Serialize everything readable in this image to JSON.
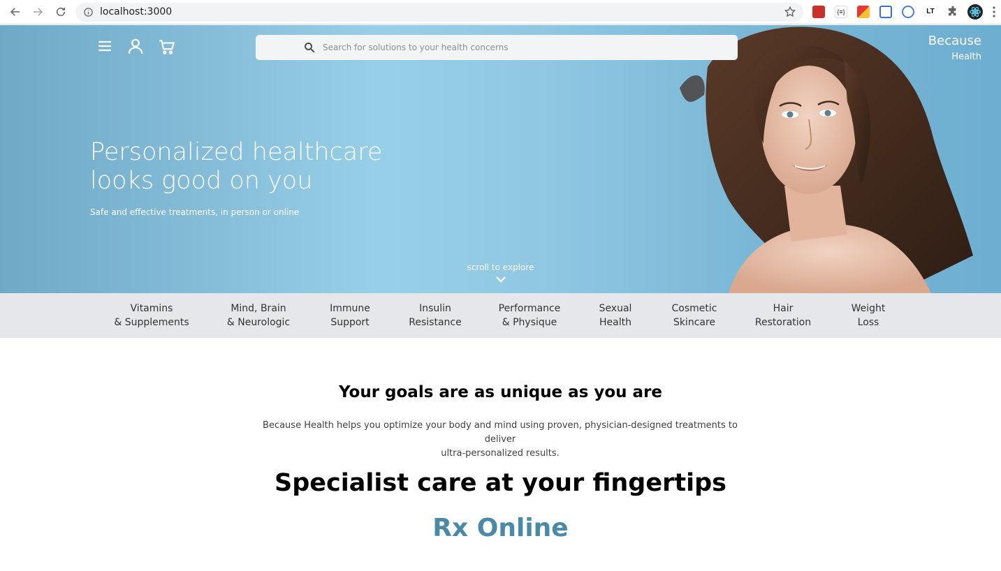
{
  "browser": {
    "url": "localhost:3000"
  },
  "search": {
    "placeholder": "Search for solutions to your health concerns"
  },
  "brand": {
    "line1": "Because",
    "line2": "Health"
  },
  "hero": {
    "headline_line1": "Personalized healthcare",
    "headline_line2": "looks good on you",
    "subtitle": "Safe and effective treatments, in person or online",
    "scroll_label": "scroll to explore"
  },
  "categories": [
    {
      "line1": "Vitamins",
      "line2": "& Supplements"
    },
    {
      "line1": "Mind, Brain",
      "line2": "& Neurologic"
    },
    {
      "line1": "Immune",
      "line2": "Support"
    },
    {
      "line1": "Insulin",
      "line2": "Resistance"
    },
    {
      "line1": "Performance",
      "line2": "& Physique"
    },
    {
      "line1": "Sexual",
      "line2": "Health"
    },
    {
      "line1": "Cosmetic",
      "line2": "Skincare"
    },
    {
      "line1": "Hair",
      "line2": "Restoration"
    },
    {
      "line1": "Weight",
      "line2": "Loss"
    }
  ],
  "content": {
    "goals_title": "Your goals are as unique as you are",
    "goals_desc_line1": "Because Health helps you optimize your body and mind using proven, physician-designed treatments to deliver",
    "goals_desc_line2": "ultra-personalized results.",
    "specialist_title": "Specialist care at your fingertips",
    "rx_title": "Rx Online"
  },
  "colors": {
    "accent": "#4a8aa6",
    "hero_blue": "#8fc7e2",
    "category_bar": "#e5e7eb"
  },
  "icons": {
    "menu": "hamburger-icon",
    "account": "user-icon",
    "cart": "cart-icon",
    "search": "search-icon",
    "scroll": "chevron-down-icon"
  }
}
